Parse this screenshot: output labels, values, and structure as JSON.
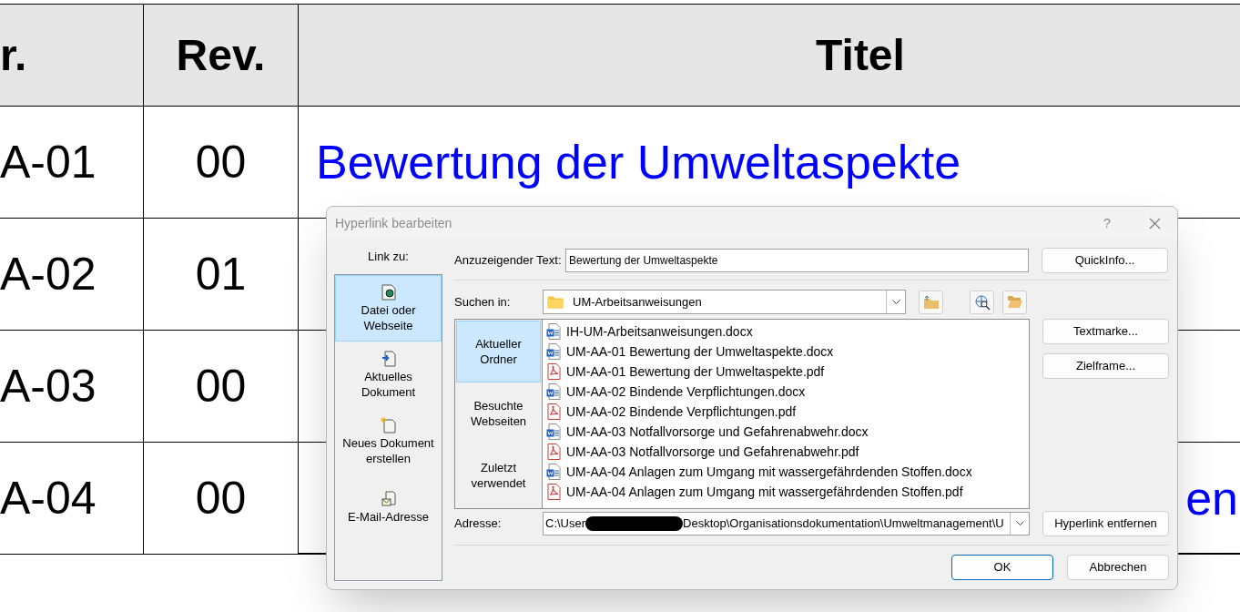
{
  "table": {
    "columns": [
      "r.",
      "Rev.",
      "Titel"
    ],
    "rows": [
      {
        "number": "A-01",
        "rev": "00",
        "title": "Bewertung der Umweltaspekte"
      },
      {
        "number": "A-02",
        "rev": "01"
      },
      {
        "number": "A-03",
        "rev": "00"
      },
      {
        "number": "A-04",
        "rev": "00",
        "title_end": "en"
      }
    ]
  },
  "dialog": {
    "title": "Hyperlink bearbeiten",
    "help": "?",
    "link_to": {
      "label": "Link zu:",
      "items": [
        {
          "label": "Datei oder Webseite",
          "kind": "file",
          "selected": true
        },
        {
          "label": "Aktuelles Dokument",
          "kind": "document",
          "selected": false
        },
        {
          "label": "Neues Dokument erstellen",
          "kind": "new",
          "selected": false
        },
        {
          "label": "E-Mail-Adresse",
          "kind": "mail",
          "selected": false
        }
      ]
    },
    "display_text": {
      "label": "Anzuzeigender Text:",
      "value": "Bewertung der Umweltaspekte"
    },
    "quickinfo_button": "QuickInfo...",
    "look_in": {
      "label": "Suchen in:",
      "value": "UM-Arbeitsanweisungen"
    },
    "browse_nav": [
      {
        "label": "Aktueller Ordner",
        "selected": true
      },
      {
        "label": "Besuchte Webseiten",
        "selected": false
      },
      {
        "label": "Zuletzt verwendet",
        "selected": false
      }
    ],
    "files": [
      {
        "name": "IH-UM-Arbeitsanweisungen.docx",
        "kind": "docx"
      },
      {
        "name": "UM-AA-01 Bewertung der Umweltaspekte.docx",
        "kind": "docx"
      },
      {
        "name": "UM-AA-01 Bewertung der Umweltaspekte.pdf",
        "kind": "pdf"
      },
      {
        "name": "UM-AA-02 Bindende Verpflichtungen.docx",
        "kind": "docx"
      },
      {
        "name": "UM-AA-02 Bindende Verpflichtungen.pdf",
        "kind": "pdf"
      },
      {
        "name": "UM-AA-03 Notfallvorsorge und Gefahrenabwehr.docx",
        "kind": "docx"
      },
      {
        "name": "UM-AA-03 Notfallvorsorge und Gefahrenabwehr.pdf",
        "kind": "pdf"
      },
      {
        "name": "UM-AA-04 Anlagen zum Umgang mit wassergefährdenden Stoffen.docx",
        "kind": "docx"
      },
      {
        "name": "UM-AA-04 Anlagen zum Umgang mit wassergefährdenden Stoffen.pdf",
        "kind": "pdf"
      }
    ],
    "side_buttons": [
      "Textmarke...",
      "Zielframe..."
    ],
    "address": {
      "label": "Adresse:",
      "start": "C:\\User",
      "end": "Desktop\\Organisationsdokumentation\\Umweltmanagement\\U"
    },
    "remove_button": "Hyperlink entfernen",
    "ok_button": "OK",
    "cancel_button": "Abbrechen"
  }
}
